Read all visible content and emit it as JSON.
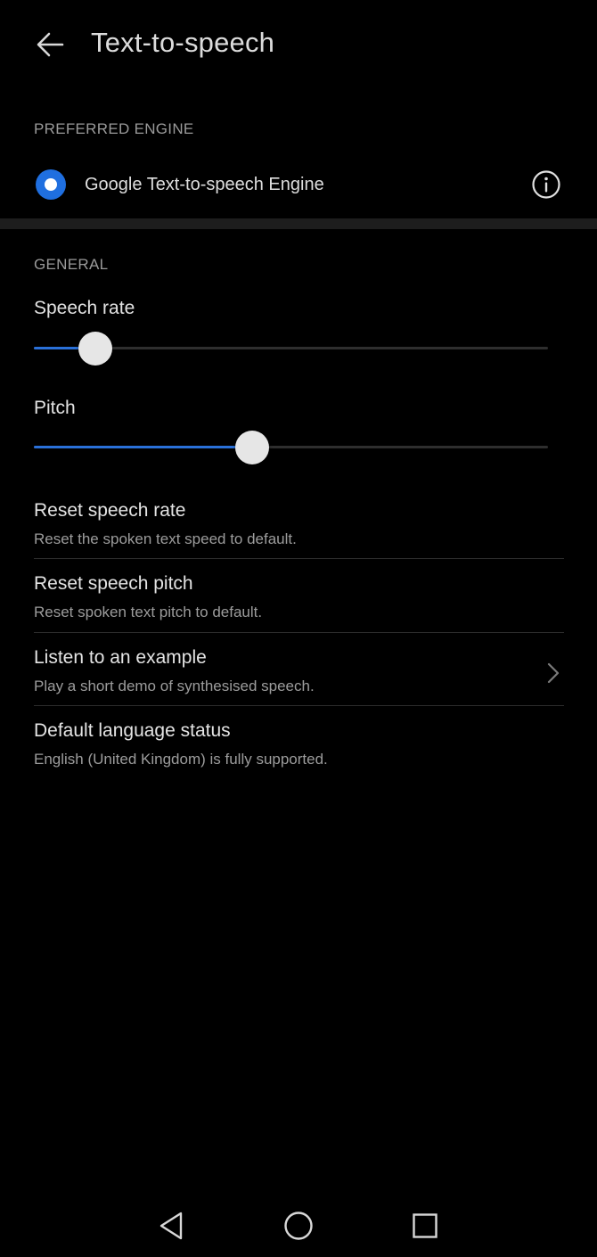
{
  "header": {
    "title": "Text-to-speech",
    "back_icon": "arrow-left-icon"
  },
  "preferred_engine": {
    "section_label": "PREFERRED ENGINE",
    "engine_name": "Google Text-to-speech Engine",
    "selected": true,
    "info_icon": "info-icon"
  },
  "general": {
    "section_label": "GENERAL",
    "speech_rate": {
      "label": "Speech rate",
      "value_percent": 12
    },
    "pitch": {
      "label": "Pitch",
      "value_percent": 42.5
    }
  },
  "items": [
    {
      "title": "Reset speech rate",
      "subtitle": "Reset the spoken text speed to default."
    },
    {
      "title": "Reset speech pitch",
      "subtitle": "Reset spoken text pitch to default."
    },
    {
      "title": "Listen to an example",
      "subtitle": "Play a short demo of synthesised speech.",
      "chevron_icon": "chevron-right-icon"
    },
    {
      "title": "Default language status",
      "subtitle": "English (United Kingdom) is fully supported."
    }
  ],
  "nav": {
    "back_icon": "triangle-back-icon",
    "home_icon": "circle-home-icon",
    "recents_icon": "square-recents-icon"
  },
  "colors": {
    "accent": "#1f6fe0",
    "background": "#000000",
    "section_divider": "#1d1d1d"
  }
}
